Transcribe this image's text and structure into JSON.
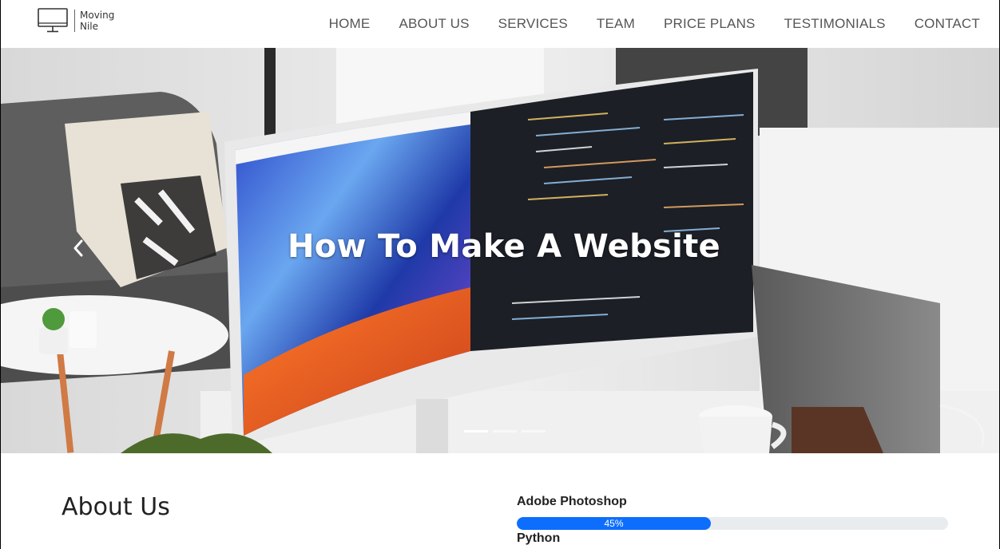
{
  "brand": {
    "line1": "Moving",
    "line2": "Nile"
  },
  "nav": {
    "items": [
      {
        "label": "HOME"
      },
      {
        "label": "ABOUT US"
      },
      {
        "label": "SERVICES"
      },
      {
        "label": "TEAM"
      },
      {
        "label": "PRICE PLANS"
      },
      {
        "label": "TESTIMONIALS"
      },
      {
        "label": "CONTACT"
      }
    ]
  },
  "hero": {
    "title": "How To Make A Website",
    "slides_count": 3,
    "active_slide": 0
  },
  "about": {
    "title": "About Us",
    "skills": [
      {
        "name": "Adobe Photoshop",
        "percent": 45,
        "percent_label": "45%"
      },
      {
        "name": "Python"
      }
    ]
  },
  "colors": {
    "progress": "#0d6efd",
    "progress_track": "#e9ecef",
    "nav_text": "#555555"
  },
  "icons": {
    "brand": "monitor-icon",
    "prev": "chevron-left-icon"
  }
}
